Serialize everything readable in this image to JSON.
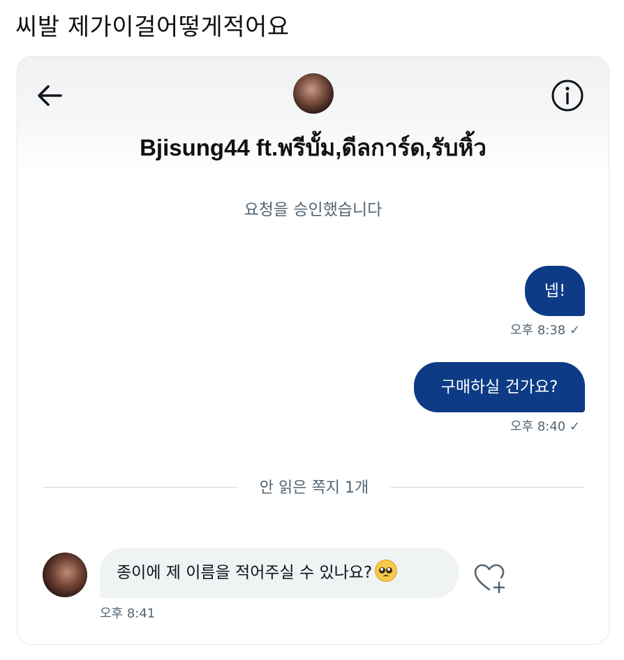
{
  "caption": "씨발 제가이걸어떻게적어요",
  "conversation": {
    "title": "Bjisung44 ft.พรีบั้ม,ดีลการ์ด,รับหิ้ว",
    "system_message": "요청을 승인했습니다",
    "outgoing": [
      {
        "text": "넵!",
        "time": "오후 8:38 ✓"
      },
      {
        "text": "구매하실 건가요?",
        "time": "오후 8:40 ✓"
      }
    ],
    "unread_divider": "안 읽은 쪽지 1개",
    "incoming": {
      "text": "종이에 제 이름을 적어주실 수 있나요?",
      "emoji": "pleading-face",
      "time": "오후 8:41"
    }
  },
  "icons": {
    "back": "arrow-left-icon",
    "info": "info-icon",
    "react": "heart-plus-icon"
  },
  "colors": {
    "outgoing_bubble": "#0d3b85",
    "incoming_bubble": "#eff3f4",
    "secondary_text": "#536471"
  }
}
